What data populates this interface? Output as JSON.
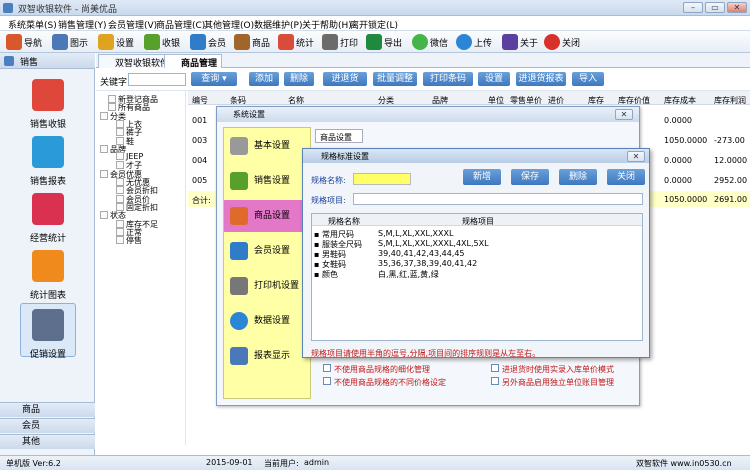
{
  "window": {
    "title": "双智收银软件 - 尚美优品",
    "buttons": [
      "–",
      "▭",
      "✕"
    ]
  },
  "menu": [
    "系统菜单(S)",
    "销售管理(Y)",
    "会员管理(V)",
    "商品管理(C)",
    "其他管理(O)",
    "数据维护(P)",
    "关于帮助(H)",
    "离开锁定(L)"
  ],
  "toolbar": [
    {
      "label": "导航",
      "icon": "home-icon",
      "color": "#d9582b"
    },
    {
      "label": "图示",
      "icon": "grid-icon",
      "color": "#4a78b8"
    },
    {
      "label": "设置",
      "icon": "settings-icon",
      "color": "#e0a31f"
    },
    {
      "label": "收银",
      "icon": "yen-icon",
      "color": "#58a02c"
    },
    {
      "label": "会员",
      "icon": "member-card-icon",
      "color": "#2f7cc8"
    },
    {
      "label": "商品",
      "icon": "box-icon",
      "color": "#a0652a"
    },
    {
      "label": "统计",
      "icon": "bar-chart-icon",
      "color": "#d94b3a"
    },
    {
      "label": "打印",
      "icon": "printer-icon",
      "color": "#6b6b6b"
    },
    {
      "label": "导出",
      "icon": "excel-icon",
      "color": "#1f8a3c"
    },
    {
      "label": "微信",
      "icon": "wechat-icon",
      "color": "#44b549"
    },
    {
      "label": "上传",
      "icon": "globe-icon",
      "color": "#2b86d6"
    },
    {
      "label": "关于",
      "icon": "about-icon",
      "color": "#5a3fa0"
    },
    {
      "label": "关闭",
      "icon": "close-icon",
      "color": "#d8312b"
    }
  ],
  "left": {
    "header": "销售",
    "items": [
      {
        "label": "销售收银",
        "icon": "cart-icon",
        "color": "#e0473b"
      },
      {
        "label": "销售报表",
        "icon": "report-icon",
        "color": "#2a9ad8"
      },
      {
        "label": "经营统计",
        "icon": "stats-icon",
        "color": "#d9314f"
      },
      {
        "label": "统计图表",
        "icon": "chart-icon",
        "color": "#f08a1c"
      },
      {
        "label": "促销设置",
        "icon": "calendar-icon",
        "color": "#5e6f8e"
      }
    ],
    "bottom": [
      "商品",
      "会员",
      "其他"
    ]
  },
  "tabs": [
    "双智收银软件",
    "商品管理"
  ],
  "filter": {
    "label": "关键字:",
    "search_btn": "查询",
    "buttons": [
      "添加",
      "删除",
      "进退货",
      "批量调整",
      "打印条码",
      "设置",
      "进退货报表",
      "导入"
    ]
  },
  "tree": [
    {
      "t": "新登记商品",
      "lvl": 1
    },
    {
      "t": "所有商品",
      "lvl": 1
    },
    {
      "t": "分类",
      "lvl": 0
    },
    {
      "t": "上衣",
      "lvl": 2
    },
    {
      "t": "裤子",
      "lvl": 2
    },
    {
      "t": "鞋",
      "lvl": 2
    },
    {
      "t": "品牌",
      "lvl": 0
    },
    {
      "t": "JEEP",
      "lvl": 2
    },
    {
      "t": "才子",
      "lvl": 2
    },
    {
      "t": "会员优惠",
      "lvl": 0
    },
    {
      "t": "无优惠",
      "lvl": 2
    },
    {
      "t": "会员折扣",
      "lvl": 2
    },
    {
      "t": "会员价",
      "lvl": 2
    },
    {
      "t": "固定折扣",
      "lvl": 2
    },
    {
      "t": "状态",
      "lvl": 0
    },
    {
      "t": "库存不足",
      "lvl": 2
    },
    {
      "t": "正常",
      "lvl": 2
    },
    {
      "t": "停售",
      "lvl": 2
    }
  ],
  "grid": {
    "headers": [
      "编号",
      "条码",
      "名称",
      "分类",
      "品牌",
      "单位",
      "零售单价",
      "进价",
      "库存",
      "库存价值",
      "库存成本",
      "库存利润"
    ],
    "rows": [
      [
        "001",
        "0.0000"
      ],
      [
        "003",
        "1050.0000",
        "-273.00"
      ],
      [
        "004",
        "0.0000",
        "12.0000"
      ],
      [
        "005",
        "0.0000",
        "2952.00"
      ],
      [
        "合计:",
        "1050.0000",
        "2691.00"
      ]
    ]
  },
  "settings": {
    "title": "系统设置",
    "nav": [
      {
        "label": "基本设置",
        "icon": "gear-icon",
        "color": "#999"
      },
      {
        "label": "销售设置",
        "icon": "yen-icon",
        "color": "#58a02c"
      },
      {
        "label": "商品设置",
        "icon": "goods-icon",
        "color": "#e06a2b"
      },
      {
        "label": "会员设置",
        "icon": "member-icon",
        "color": "#2f7cc8"
      },
      {
        "label": "打印机设置",
        "icon": "printer-icon",
        "color": "#777"
      },
      {
        "label": "数据设置",
        "icon": "globe-icon",
        "color": "#2b86d6"
      },
      {
        "label": "报表显示",
        "icon": "table-icon",
        "color": "#4a78b8"
      }
    ],
    "group": "商品设置",
    "checks": [
      "不使用商品规格的细化管理",
      "进退货时使用实录入库单价模式",
      "不使用商品规格的不同价格设定",
      "另外商品启用独立单位账目管理"
    ]
  },
  "spec": {
    "title": "规格标准设置",
    "name_label": "规格名称:",
    "items_label": "规格项目:",
    "buttons": [
      "新增",
      "保存",
      "删除",
      "关闭"
    ],
    "col1": "规格名称",
    "col2": "规格项目",
    "rows": [
      [
        "常用尺码",
        "S,M,L,XL,XXL,XXXL"
      ],
      [
        "服装全尺码",
        "S,M,L,XL,XXL,XXXL,4XL,5XL"
      ],
      [
        "男鞋码",
        "39,40,41,42,43,44,45"
      ],
      [
        "女鞋码",
        "35,36,37,38,39,40,41,42"
      ],
      [
        "颜色",
        "白,黑,红,蓝,黄,绿"
      ]
    ],
    "hint": "规格项目请使用半角的逗号,分隔,项目间的排序规则是从左至右。"
  },
  "status": {
    "version": "单机版 Ver:6.2",
    "date": "2015-09-01",
    "user_label": "当前用户:",
    "user": "admin",
    "brand": "双智软件 www.in0530.cn"
  }
}
